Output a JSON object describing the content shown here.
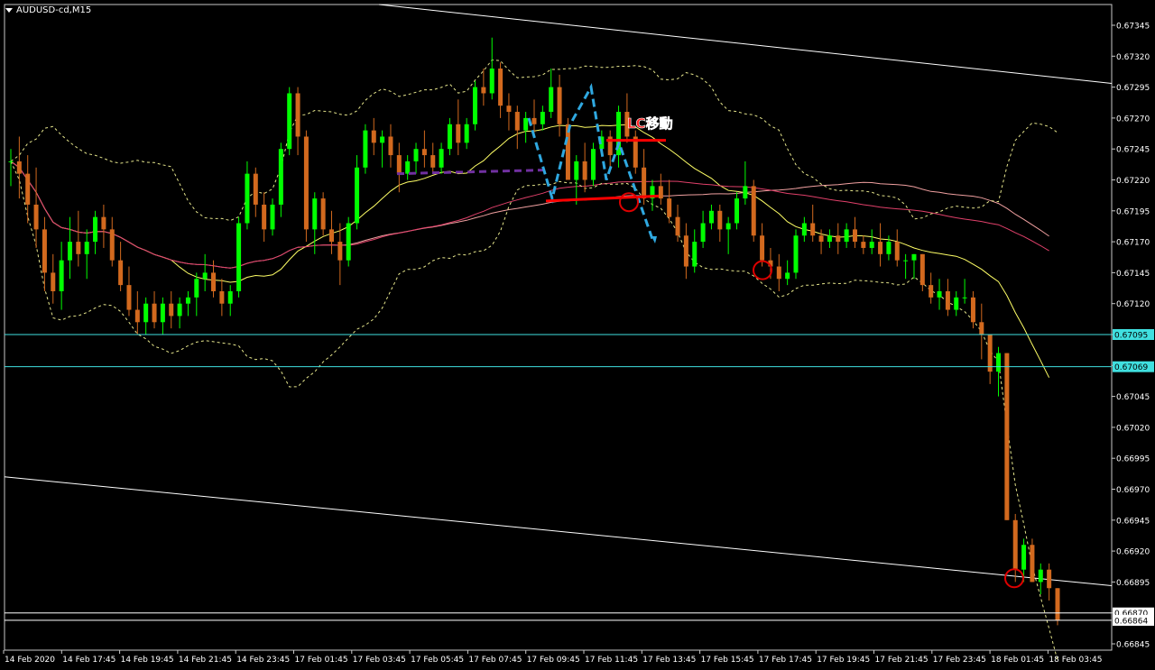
{
  "window": {
    "symbol_label": "AUDUSD-cd,M15"
  },
  "annotation": {
    "lc_label": "LC移動"
  },
  "colors": {
    "background": "#000000",
    "bull": "#00ff00",
    "bear": "#d2691e",
    "ma_short": "#ffff66",
    "ma_mid": "#f0a0a0",
    "ma_long": "#e0406a",
    "bands": "#e6e68c",
    "channel": "#ffffff",
    "hline": "#40e0e0",
    "pattern": "#2fa8e0",
    "neckline": "#7030a0",
    "lc_line": "#ff0000",
    "axis_text": "#ffffff",
    "circle": "#dd0000"
  },
  "chart_data": {
    "type": "candlestick",
    "symbol": "AUDUSD-cd",
    "timeframe": "M15",
    "ylim": [
      0.66845,
      0.67352
    ],
    "y_ticks": [
      0.67345,
      0.6732,
      0.67295,
      0.6727,
      0.67245,
      0.6722,
      0.67195,
      0.6717,
      0.67145,
      0.6712,
      0.67095,
      0.6707,
      0.67045,
      0.6702,
      0.66995,
      0.6697,
      0.66945,
      0.6692,
      0.66895,
      0.6687,
      0.66845
    ],
    "y_tick_labels": [
      "0.67345",
      "0.67320",
      "0.67295",
      "0.67270",
      "0.67245",
      "0.67220",
      "0.67195",
      "0.67170",
      "0.67145",
      "0.67120",
      "0.67095",
      "0.67070",
      "0.67045",
      "0.67020",
      "0.66995",
      "0.66970",
      "0.66945",
      "0.66920",
      "0.66895",
      "0.66870",
      "0.66845"
    ],
    "x_ticks": [
      "14 Feb 2020",
      "14 Feb 17:45",
      "14 Feb 19:45",
      "14 Feb 21:45",
      "14 Feb 23:45",
      "17 Feb 01:45",
      "17 Feb 03:45",
      "17 Feb 05:45",
      "17 Feb 07:45",
      "17 Feb 09:45",
      "17 Feb 11:45",
      "17 Feb 13:45",
      "17 Feb 15:45",
      "17 Feb 17:45",
      "17 Feb 19:45",
      "17 Feb 21:45",
      "17 Feb 23:45",
      "18 Feb 01:45",
      "18 Feb 03:45"
    ],
    "horizontal_levels": [
      {
        "price": 0.67095,
        "label": "0.67095",
        "color": "#40e0e0"
      },
      {
        "price": 0.67069,
        "label": "0.67069",
        "color": "#40e0e0"
      },
      {
        "price": 0.6687,
        "label": "0.66870",
        "color": "#ffffff"
      },
      {
        "price": 0.66864,
        "label": "0.66864",
        "color": "#ffffff"
      }
    ],
    "candles": [
      [
        0.67235,
        0.67245,
        0.67215,
        0.67235
      ],
      [
        0.67235,
        0.67255,
        0.67205,
        0.67225
      ],
      [
        0.67225,
        0.6724,
        0.67185,
        0.672
      ],
      [
        0.672,
        0.6723,
        0.67165,
        0.6718
      ],
      [
        0.6718,
        0.6719,
        0.6713,
        0.67145
      ],
      [
        0.67145,
        0.6716,
        0.6712,
        0.6713
      ],
      [
        0.6713,
        0.6717,
        0.67115,
        0.67155
      ],
      [
        0.67155,
        0.6719,
        0.6714,
        0.6717
      ],
      [
        0.6717,
        0.67195,
        0.6715,
        0.6716
      ],
      [
        0.6716,
        0.6718,
        0.6714,
        0.6717
      ],
      [
        0.6717,
        0.67195,
        0.6716,
        0.6719
      ],
      [
        0.6719,
        0.672,
        0.67165,
        0.6718
      ],
      [
        0.6718,
        0.6719,
        0.6715,
        0.67155
      ],
      [
        0.67155,
        0.6717,
        0.6713,
        0.67135
      ],
      [
        0.67135,
        0.6715,
        0.6711,
        0.67115
      ],
      [
        0.67115,
        0.6713,
        0.67095,
        0.67105
      ],
      [
        0.67105,
        0.67125,
        0.67095,
        0.6712
      ],
      [
        0.6712,
        0.6713,
        0.671,
        0.67105
      ],
      [
        0.67105,
        0.67125,
        0.67095,
        0.6712
      ],
      [
        0.6712,
        0.6713,
        0.671,
        0.6711
      ],
      [
        0.6711,
        0.67125,
        0.671,
        0.6712
      ],
      [
        0.6712,
        0.6713,
        0.6711,
        0.67125
      ],
      [
        0.67125,
        0.67145,
        0.6711,
        0.6714
      ],
      [
        0.6714,
        0.6716,
        0.6713,
        0.67145
      ],
      [
        0.67145,
        0.67155,
        0.67125,
        0.6713
      ],
      [
        0.6713,
        0.6714,
        0.6711,
        0.6712
      ],
      [
        0.6712,
        0.67135,
        0.6711,
        0.6713
      ],
      [
        0.6713,
        0.6719,
        0.67125,
        0.67185
      ],
      [
        0.67185,
        0.67235,
        0.6718,
        0.67225
      ],
      [
        0.67225,
        0.6723,
        0.6719,
        0.672
      ],
      [
        0.672,
        0.6721,
        0.6717,
        0.6718
      ],
      [
        0.6718,
        0.67205,
        0.67175,
        0.672
      ],
      [
        0.672,
        0.6725,
        0.6719,
        0.67245
      ],
      [
        0.67245,
        0.67295,
        0.6724,
        0.6729
      ],
      [
        0.6729,
        0.67295,
        0.6724,
        0.67255
      ],
      [
        0.67255,
        0.6726,
        0.6717,
        0.6718
      ],
      [
        0.6718,
        0.6721,
        0.6716,
        0.67205
      ],
      [
        0.67205,
        0.6721,
        0.67175,
        0.6718
      ],
      [
        0.6718,
        0.67195,
        0.6716,
        0.6717
      ],
      [
        0.6717,
        0.67185,
        0.67135,
        0.67155
      ],
      [
        0.67155,
        0.6719,
        0.6715,
        0.67185
      ],
      [
        0.67185,
        0.6724,
        0.6718,
        0.6723
      ],
      [
        0.6723,
        0.67265,
        0.67225,
        0.6726
      ],
      [
        0.6726,
        0.6727,
        0.6724,
        0.6725
      ],
      [
        0.6725,
        0.6726,
        0.6723,
        0.67255
      ],
      [
        0.67255,
        0.67265,
        0.6723,
        0.6724
      ],
      [
        0.6724,
        0.6725,
        0.6721,
        0.67225
      ],
      [
        0.67225,
        0.6724,
        0.6722,
        0.67235
      ],
      [
        0.67235,
        0.6725,
        0.67225,
        0.67245
      ],
      [
        0.67245,
        0.6726,
        0.6723,
        0.6724
      ],
      [
        0.6724,
        0.6725,
        0.67225,
        0.6723
      ],
      [
        0.6723,
        0.6725,
        0.67225,
        0.67245
      ],
      [
        0.67245,
        0.6727,
        0.6724,
        0.67265
      ],
      [
        0.67265,
        0.67285,
        0.6724,
        0.6725
      ],
      [
        0.6725,
        0.6727,
        0.67245,
        0.67265
      ],
      [
        0.67265,
        0.673,
        0.6726,
        0.67295
      ],
      [
        0.67295,
        0.6731,
        0.6728,
        0.6729
      ],
      [
        0.6729,
        0.67335,
        0.67285,
        0.6731
      ],
      [
        0.6731,
        0.67315,
        0.6727,
        0.6728
      ],
      [
        0.6728,
        0.6729,
        0.6726,
        0.67275
      ],
      [
        0.67275,
        0.6728,
        0.67245,
        0.6726
      ],
      [
        0.6726,
        0.67275,
        0.6725,
        0.6727
      ],
      [
        0.6727,
        0.67285,
        0.67255,
        0.67265
      ],
      [
        0.67265,
        0.6728,
        0.6726,
        0.67275
      ],
      [
        0.67275,
        0.6731,
        0.6727,
        0.67295
      ],
      [
        0.67295,
        0.67305,
        0.67255,
        0.67265
      ],
      [
        0.67265,
        0.6727,
        0.6722,
        0.6722
      ],
      [
        0.6722,
        0.6724,
        0.672,
        0.67235
      ],
      [
        0.67235,
        0.6725,
        0.6721,
        0.6722
      ],
      [
        0.6722,
        0.6725,
        0.67215,
        0.67245
      ],
      [
        0.67245,
        0.6726,
        0.6724,
        0.67255
      ],
      [
        0.67255,
        0.6726,
        0.6723,
        0.6724
      ],
      [
        0.6724,
        0.6728,
        0.6723,
        0.67275
      ],
      [
        0.67275,
        0.6729,
        0.6725,
        0.67255
      ],
      [
        0.67255,
        0.6726,
        0.67225,
        0.6723
      ],
      [
        0.6723,
        0.67245,
        0.672,
        0.67205
      ],
      [
        0.67205,
        0.6722,
        0.67195,
        0.67215
      ],
      [
        0.67215,
        0.67225,
        0.672,
        0.67205
      ],
      [
        0.67205,
        0.6722,
        0.67185,
        0.6719
      ],
      [
        0.6719,
        0.672,
        0.6717,
        0.67175
      ],
      [
        0.67175,
        0.67185,
        0.6714,
        0.6715
      ],
      [
        0.6715,
        0.6718,
        0.67145,
        0.6717
      ],
      [
        0.6717,
        0.67195,
        0.67165,
        0.67185
      ],
      [
        0.67185,
        0.672,
        0.6718,
        0.67195
      ],
      [
        0.67195,
        0.672,
        0.6717,
        0.6718
      ],
      [
        0.6718,
        0.6719,
        0.6716,
        0.67185
      ],
      [
        0.67185,
        0.6721,
        0.6718,
        0.67205
      ],
      [
        0.67205,
        0.67235,
        0.672,
        0.67215
      ],
      [
        0.67215,
        0.6722,
        0.6717,
        0.67175
      ],
      [
        0.67175,
        0.67185,
        0.6715,
        0.67155
      ],
      [
        0.67155,
        0.67165,
        0.6714,
        0.6715
      ],
      [
        0.6715,
        0.6716,
        0.6713,
        0.6714
      ],
      [
        0.6714,
        0.67155,
        0.67135,
        0.67145
      ],
      [
        0.67145,
        0.6718,
        0.6714,
        0.67175
      ],
      [
        0.67175,
        0.6719,
        0.6717,
        0.67185
      ],
      [
        0.67185,
        0.672,
        0.6717,
        0.67175
      ],
      [
        0.67175,
        0.6718,
        0.6716,
        0.6717
      ],
      [
        0.6717,
        0.6718,
        0.67165,
        0.67175
      ],
      [
        0.67175,
        0.67185,
        0.6716,
        0.6717
      ],
      [
        0.6717,
        0.67185,
        0.67165,
        0.6718
      ],
      [
        0.6718,
        0.6719,
        0.67165,
        0.6717
      ],
      [
        0.6717,
        0.67175,
        0.6716,
        0.67165
      ],
      [
        0.67165,
        0.6718,
        0.6716,
        0.6717
      ],
      [
        0.6717,
        0.67185,
        0.6715,
        0.6716
      ],
      [
        0.6716,
        0.67175,
        0.67155,
        0.6717
      ],
      [
        0.6717,
        0.6718,
        0.6715,
        0.67155
      ],
      [
        0.67155,
        0.6716,
        0.6714,
        0.67155
      ],
      [
        0.67155,
        0.6716,
        0.6714,
        0.6716
      ],
      [
        0.6716,
        0.6716,
        0.6713,
        0.67135
      ],
      [
        0.67135,
        0.67145,
        0.6712,
        0.67125
      ],
      [
        0.67125,
        0.6714,
        0.67115,
        0.6713
      ],
      [
        0.6713,
        0.6714,
        0.6711,
        0.67115
      ],
      [
        0.67115,
        0.6713,
        0.6711,
        0.67125
      ],
      [
        0.67125,
        0.6714,
        0.6712,
        0.67125
      ],
      [
        0.67125,
        0.6713,
        0.671,
        0.67105
      ],
      [
        0.67105,
        0.6712,
        0.67075,
        0.67095
      ],
      [
        0.67095,
        0.67095,
        0.67055,
        0.67065
      ],
      [
        0.67065,
        0.67085,
        0.67045,
        0.6708
      ],
      [
        0.6708,
        0.6708,
        0.66945,
        0.66945
      ],
      [
        0.66945,
        0.6695,
        0.66895,
        0.66905
      ],
      [
        0.66905,
        0.6693,
        0.66895,
        0.66925
      ],
      [
        0.66925,
        0.6693,
        0.66895,
        0.66895
      ],
      [
        0.66895,
        0.6691,
        0.66885,
        0.66905
      ],
      [
        0.66905,
        0.6691,
        0.6688,
        0.6689
      ],
      [
        0.6689,
        0.6689,
        0.6686,
        0.66864
      ]
    ]
  }
}
